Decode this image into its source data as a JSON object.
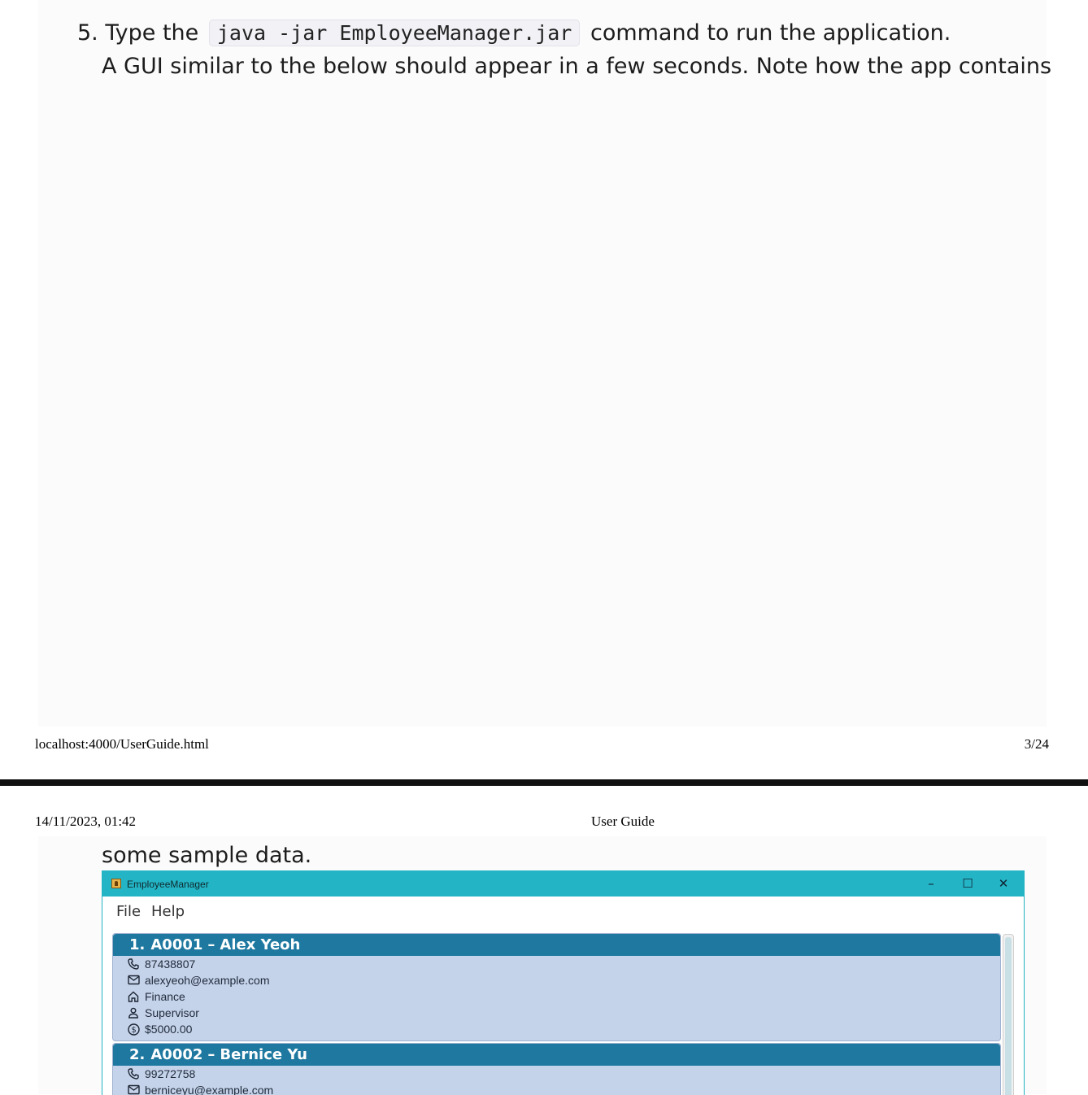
{
  "step": {
    "number": "5.",
    "before": "Type the",
    "command": "java -jar EmployeeManager.jar",
    "after": "command to run the application.",
    "description": "A GUI similar to the below should appear in a few seconds. Note how the app contains",
    "continuation": "some sample data."
  },
  "footer": {
    "url": "localhost:4000/UserGuide.html",
    "page": "3/24"
  },
  "header": {
    "datetime": "14/11/2023, 01:42",
    "title": "User Guide"
  },
  "app": {
    "window_title": "EmployeeManager",
    "controls": {
      "minimize": "–",
      "maximize": "☐",
      "close": "✕"
    },
    "menu": {
      "file": "File",
      "help": "Help"
    },
    "employees": [
      {
        "index": "1.",
        "id": "A0001",
        "separator": "–",
        "name": "Alex Yeoh",
        "phone": "87438807",
        "email": "alexyeoh@example.com",
        "department": "Finance",
        "role": "Supervisor",
        "salary": "$5000.00"
      },
      {
        "index": "2.",
        "id": "A0002",
        "separator": "–",
        "name": "Bernice Yu",
        "phone": "99272758",
        "email": "berniceyu@example.com"
      }
    ],
    "colors": {
      "titlebar": "#23b4c5",
      "card_header": "#1f78a0",
      "card_body": "#c5d3ea"
    }
  }
}
